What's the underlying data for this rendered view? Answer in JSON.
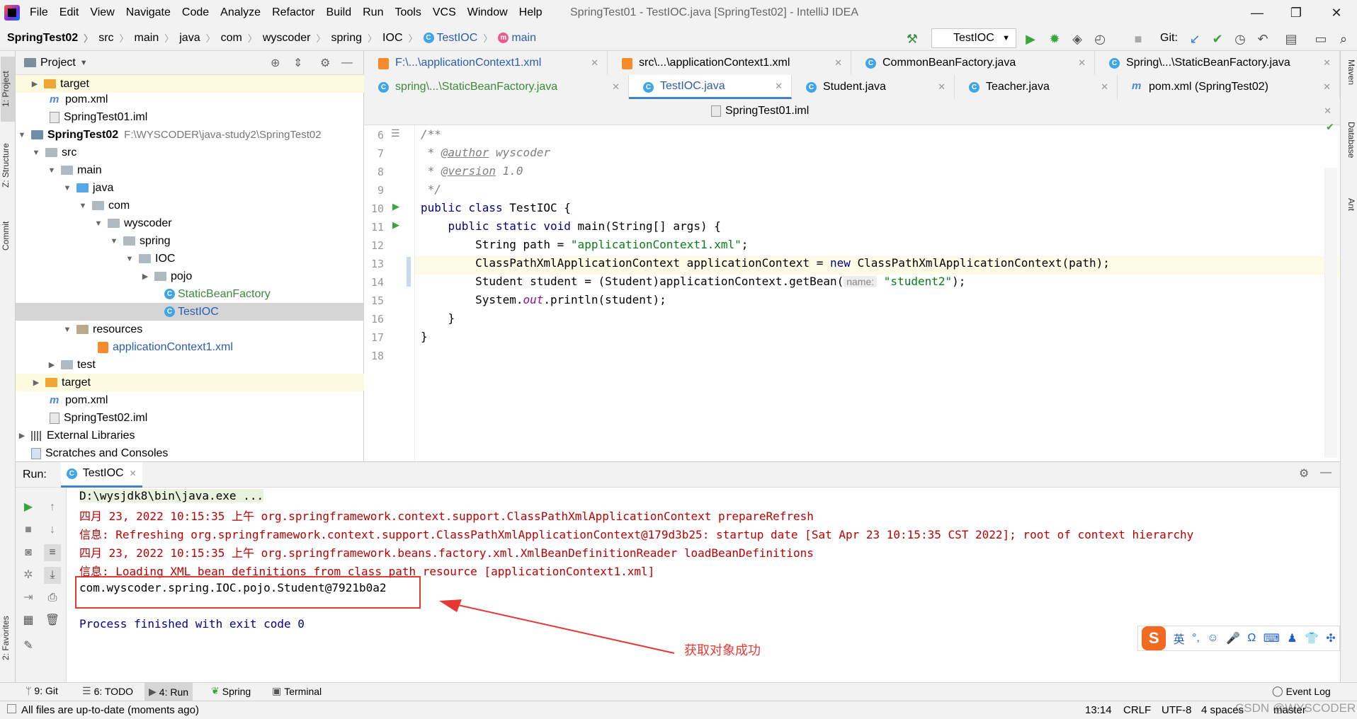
{
  "window": {
    "title": "SpringTest01 - TestIOC.java [SpringTest02] - IntelliJ IDEA"
  },
  "menu": [
    "File",
    "Edit",
    "View",
    "Navigate",
    "Code",
    "Analyze",
    "Refactor",
    "Build",
    "Run",
    "Tools",
    "VCS",
    "Window",
    "Help"
  ],
  "breadcrumb": [
    "SpringTest02",
    "src",
    "main",
    "java",
    "com",
    "wyscoder",
    "spring",
    "IOC",
    "TestIOC",
    "main"
  ],
  "toolbar": {
    "run_config": "TestIOC",
    "git_label": "Git:"
  },
  "project": {
    "header": "Project",
    "rows": [
      {
        "label": "target",
        "path": ""
      },
      {
        "label": "pom.xml",
        "path": ""
      },
      {
        "label": "SpringTest01.iml",
        "path": ""
      },
      {
        "label": "SpringTest02",
        "path": "F:\\WYSCODER\\java-study2\\SpringTest02"
      },
      {
        "label": "src",
        "path": ""
      },
      {
        "label": "main",
        "path": ""
      },
      {
        "label": "java",
        "path": ""
      },
      {
        "label": "com",
        "path": ""
      },
      {
        "label": "wyscoder",
        "path": ""
      },
      {
        "label": "spring",
        "path": ""
      },
      {
        "label": "IOC",
        "path": ""
      },
      {
        "label": "pojo",
        "path": ""
      },
      {
        "label": "StaticBeanFactory",
        "path": ""
      },
      {
        "label": "TestIOC",
        "path": ""
      },
      {
        "label": "resources",
        "path": ""
      },
      {
        "label": "applicationContext1.xml",
        "path": ""
      },
      {
        "label": "test",
        "path": ""
      },
      {
        "label": "target",
        "path": ""
      },
      {
        "label": "pom.xml",
        "path": ""
      },
      {
        "label": "SpringTest02.iml",
        "path": ""
      },
      {
        "label": "External Libraries",
        "path": ""
      },
      {
        "label": "Scratches and Consoles",
        "path": ""
      }
    ]
  },
  "tabs": {
    "row1": [
      "F:\\...\\applicationContext1.xml",
      "src\\...\\applicationContext1.xml",
      "CommonBeanFactory.java",
      "Spring\\...\\StaticBeanFactory.java"
    ],
    "row2": [
      "spring\\...\\StaticBeanFactory.java",
      "TestIOC.java",
      "Student.java",
      "Teacher.java",
      "pom.xml (SpringTest02)"
    ],
    "row3": [
      "SpringTest01.iml"
    ]
  },
  "editor": {
    "line_numbers": [
      "6",
      "7",
      "8",
      "9",
      "10",
      "11",
      "12",
      "13",
      "14",
      "15",
      "16",
      "17",
      "18"
    ],
    "code": {
      "l6": "/**",
      "l7_prefix": " * ",
      "l7_tag": "@author",
      "l7_val": " wyscoder",
      "l8_prefix": " * ",
      "l8_tag": "@version",
      "l8_val": " 1.0",
      "l9": " */",
      "l10_kw": "public class",
      "l10_rest": " TestIOC {",
      "l11_kw": "    public static void",
      "l11_rest": " main(String[] args) {",
      "l12_a": "        String path = ",
      "l12_str": "\"applicationContext1.xml\"",
      "l12_b": ";",
      "l13_a": "        ClassPathXmlApplicationContext applicationContext = ",
      "l13_kw": "new",
      "l13_b": " ClassPathXmlApplicationContext(path);",
      "l14_a": "        Student student = (Student)applicationContext.getBean(",
      "l14_hint": "name:",
      "l14_str": "\"student2\"",
      "l14_b": ");",
      "l15_a": "        System.",
      "l15_out": "out",
      "l15_b": ".println(student);",
      "l16": "    }",
      "l17": "}"
    }
  },
  "run": {
    "label": "Run:",
    "tab": "TestIOC",
    "lines": [
      "D:\\wysjdk8\\bin\\java.exe ...",
      "四月 23, 2022 10:15:35 上午 org.springframework.context.support.ClassPathXmlApplicationContext prepareRefresh",
      "信息: Refreshing org.springframework.context.support.ClassPathXmlApplicationContext@179d3b25: startup date [Sat Apr 23 10:15:35 CST 2022]; root of context hierarchy",
      "四月 23, 2022 10:15:35 上午 org.springframework.beans.factory.xml.XmlBeanDefinitionReader loadBeanDefinitions",
      "信息: Loading XML bean definitions from class path resource [applicationContext1.xml]",
      "com.wyscoder.spring.IOC.pojo.Student@7921b0a2",
      "Process finished with exit code 0"
    ],
    "annotation": "获取对象成功"
  },
  "ime": {
    "lang": "英"
  },
  "left_stripe": [
    "1: Project",
    "Z: Structure",
    "Commit",
    "2: Favorites"
  ],
  "right_stripe": [
    "Maven",
    "Database",
    "Ant"
  ],
  "bottom_tools": [
    "9: Git",
    "6: TODO",
    "4: Run",
    "Spring",
    "Terminal",
    "Event Log"
  ],
  "status": {
    "message": "All files are up-to-date (moments ago)",
    "position": "13:14",
    "line_sep": "CRLF",
    "encoding": "UTF-8",
    "indent": "4 spaces",
    "branch": "master",
    "watermark": "CSDN @WYSCODER"
  },
  "colors": {
    "accent": "#4083c9",
    "error_red": "#b00000",
    "annotation_red": "#e53935"
  }
}
